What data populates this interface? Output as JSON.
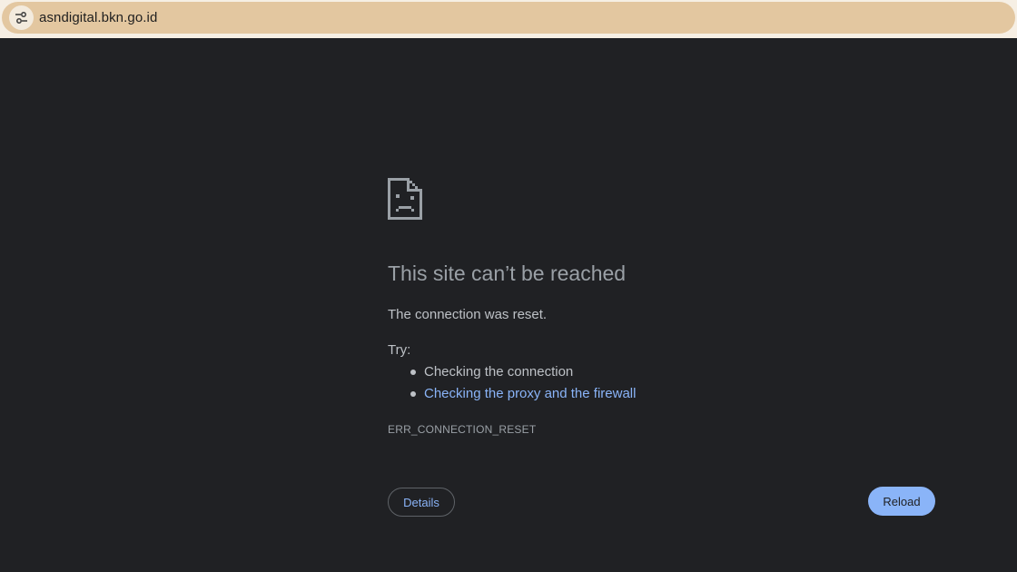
{
  "address_bar": {
    "url": "asndigital.bkn.go.id",
    "site_info_icon": "tune-icon"
  },
  "error_page": {
    "icon": "sad-page-icon",
    "headline": "This site can’t be reached",
    "message": "The connection was reset.",
    "try_label": "Try:",
    "suggestions": [
      {
        "text": "Checking the connection",
        "is_link": false
      },
      {
        "text": "Checking the proxy and the firewall",
        "is_link": true
      }
    ],
    "error_code": "ERR_CONNECTION_RESET",
    "details_button": "Details",
    "reload_button": "Reload"
  },
  "colors": {
    "background": "#202124",
    "link": "#8ab4f8",
    "omnibox": "#e3c7a0"
  }
}
